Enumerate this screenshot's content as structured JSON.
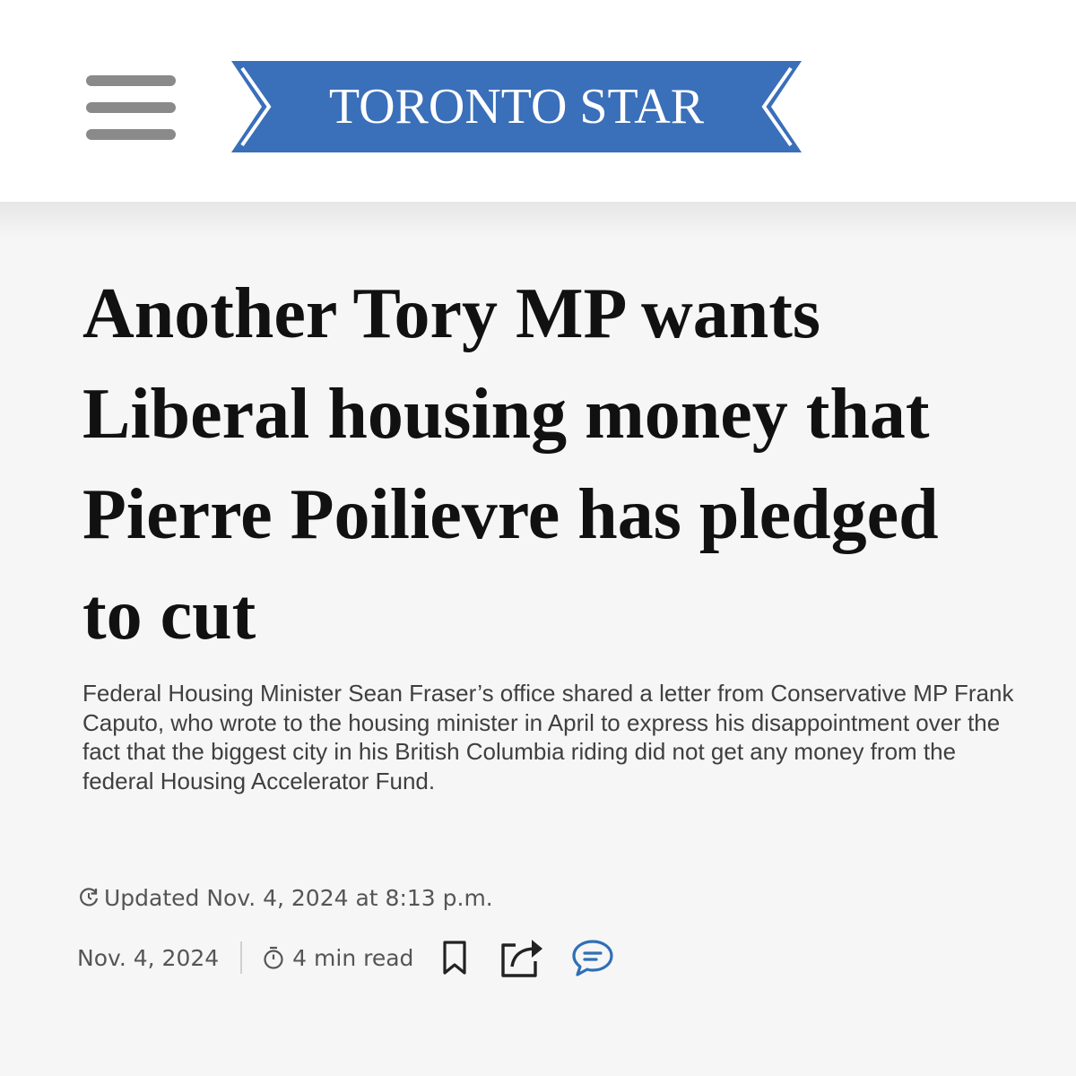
{
  "header": {
    "menu_icon": "hamburger-menu-icon",
    "logo_text": "TORONTO STAR",
    "logo_color": "#3a6fb9"
  },
  "article": {
    "headline": "Another Tory MP wants Liberal housing money that Pierre Poilievre has pledged to cut",
    "deck": "Federal Housing Minister Sean Fraser’s office shared a letter from Conservative MP Frank Caputo, who wrote to the housing minister in April to express his disappointment over the fact that the biggest city in his British Columbia riding did not get any money from the federal Housing Accelerator Fund.",
    "updated": "Updated Nov. 4, 2024 at 8:13 p.m.",
    "date": "Nov. 4, 2024",
    "read_time": "4 min read"
  },
  "icons": {
    "updated": "refresh-clock-icon",
    "read_time": "stopwatch-icon",
    "bookmark": "bookmark-icon",
    "share": "share-icon",
    "comment": "comment-icon",
    "comment_color": "#2f6fb7"
  }
}
